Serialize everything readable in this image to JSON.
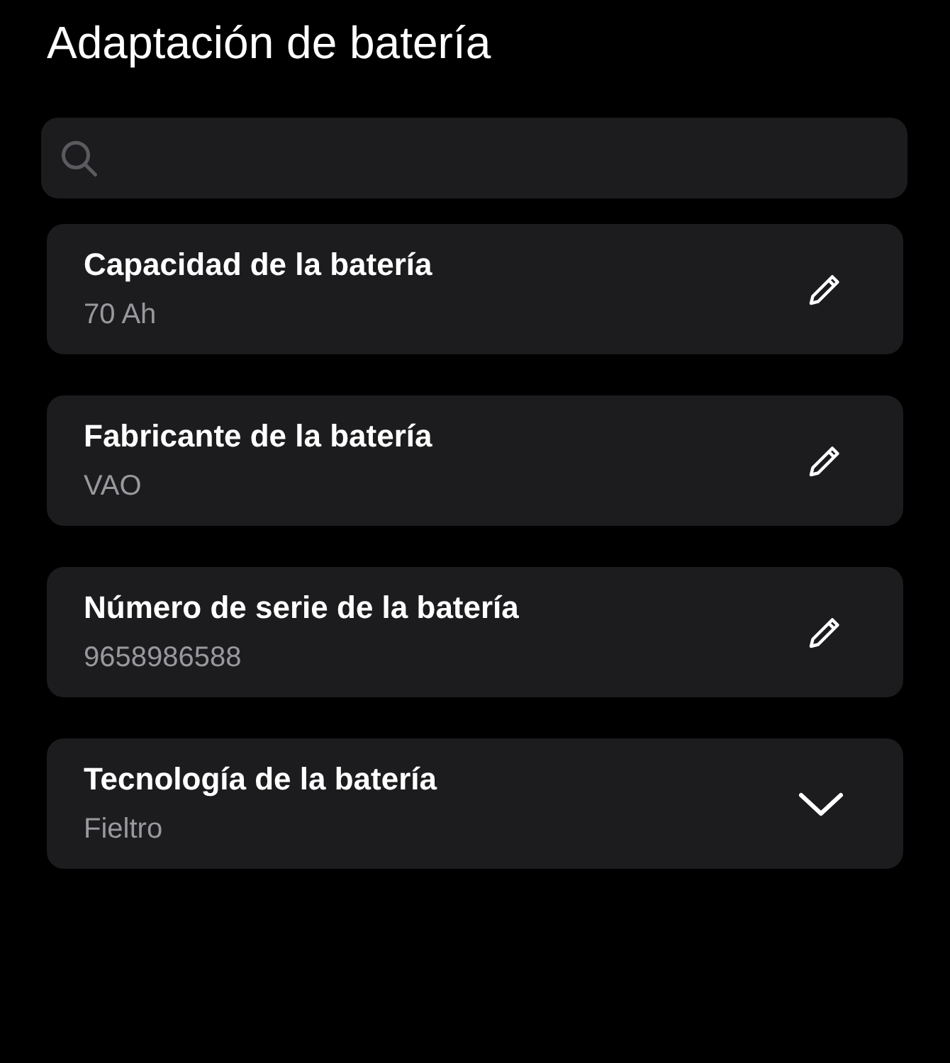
{
  "title": "Adaptación de batería",
  "items": [
    {
      "label": "Capacidad de la batería",
      "value": "70 Ah",
      "kind": "edit"
    },
    {
      "label": "Fabricante de la batería",
      "value": "VAO",
      "kind": "edit"
    },
    {
      "label": "Número de serie de la batería",
      "value": "9658986588",
      "kind": "edit"
    },
    {
      "label": "Tecnología de la batería",
      "value": "Fieltro",
      "kind": "select"
    }
  ]
}
